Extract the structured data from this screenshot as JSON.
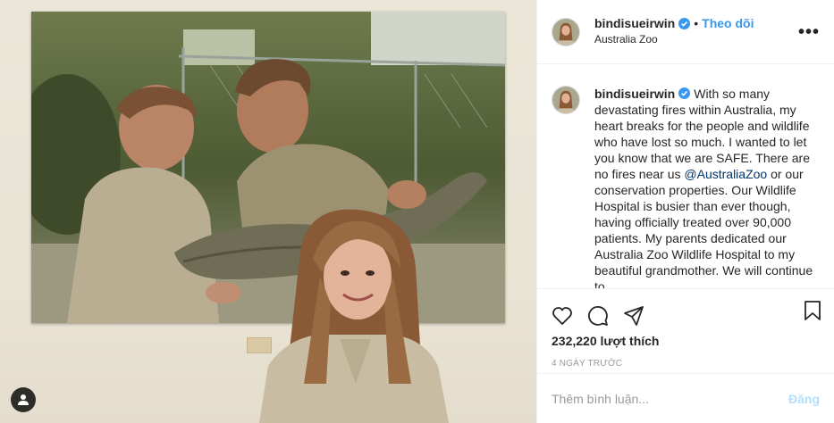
{
  "post": {
    "photo_description_tag": "user-tag-icon",
    "tag_button_icon": "person-icon"
  },
  "header": {
    "username": "bindisueirwin",
    "verified_icon": "verified-badge-icon",
    "separator": "•",
    "follow_label": "Theo dõi",
    "location": "Australia Zoo",
    "more_icon": "more-options-icon",
    "more_label": "•••"
  },
  "caption": {
    "username": "bindisueirwin",
    "text_before_mention": "With so many devastating fires within Australia, my heart breaks for the people and wildlife who have lost so much. I wanted to let you know that we are SAFE. There are no fires near us ",
    "mention": "@AustraliaZoo",
    "text_after_mention": " or our conservation properties. Our Wildlife Hospital is busier than ever though, having officially treated over 90,000 patients. My parents dedicated our Australia Zoo Wildlife Hospital to my beautiful grandmother. We will continue to"
  },
  "actions": {
    "like_icon": "heart-icon",
    "comment_icon": "comment-icon",
    "share_icon": "share-icon",
    "save_icon": "bookmark-icon"
  },
  "likes": "232,220 lượt thích",
  "timestamp": "4 NGÀY TRƯỚC",
  "add_comment": {
    "placeholder": "Thêm bình luận...",
    "post_label": "Đăng"
  },
  "colors": {
    "link_blue": "#3897f0",
    "mention_blue": "#003569",
    "post_disabled": "#b2dffc",
    "border": "#efefef",
    "muted": "#999999"
  }
}
